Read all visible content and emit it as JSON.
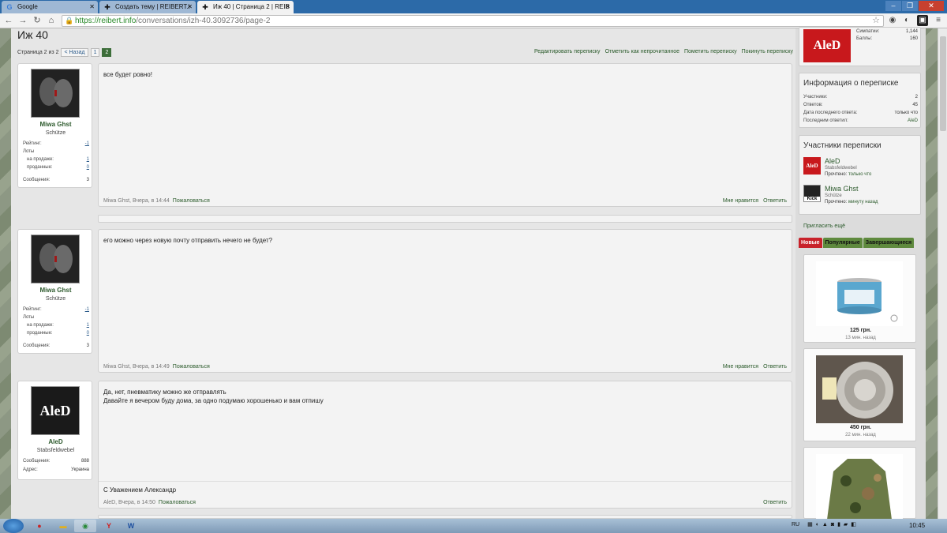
{
  "browser": {
    "tabs": [
      {
        "label": "Google",
        "icon": "google-icon"
      },
      {
        "label": "Создать тему | REIBERT.i",
        "icon": "reibert-icon"
      },
      {
        "label": "Иж 40 | Страница 2 | REIB",
        "icon": "reibert-icon"
      }
    ],
    "url_host": "https://reibert.info",
    "url_path": "/conversations/izh-40.3092736/page-2"
  },
  "page": {
    "title": "Иж 40",
    "page_label": "Страница 2 из 2",
    "prev_label": "< Назад",
    "pages": [
      "1",
      "2"
    ],
    "current_page": "2",
    "actions": [
      "Редактировать переписку",
      "Отметить как непрочитанное",
      "Пометить переписку",
      "Покинуть переписку"
    ]
  },
  "posts": [
    {
      "author": "Miwa Ghst",
      "rank": "Schütze",
      "stats": [
        {
          "label": "Рейтинг:",
          "value": "-1"
        },
        {
          "label": "Лоты",
          "value": ""
        },
        {
          "label": "на продаже:",
          "value": "1"
        },
        {
          "label": "проданные:",
          "value": "0"
        },
        {
          "label": "Сообщения:",
          "value": "3"
        }
      ],
      "text": "все будет ровно!",
      "meta": "Miwa Ghst, Вчера, в 14:44",
      "report": "Пожаловаться",
      "like": "Мне нравится",
      "reply": "Ответить"
    },
    {
      "author": "Miwa Ghst",
      "rank": "Schütze",
      "stats": [
        {
          "label": "Рейтинг:",
          "value": "-1"
        },
        {
          "label": "Лоты",
          "value": ""
        },
        {
          "label": "на продаже:",
          "value": "1"
        },
        {
          "label": "проданные:",
          "value": "0"
        },
        {
          "label": "Сообщения:",
          "value": "3"
        }
      ],
      "text": "его можно через новую почту отправить нечего не будет?",
      "meta": "Miwa Ghst, Вчера, в 14:49",
      "report": "Пожаловаться",
      "like": "Мне нравится",
      "reply": "Ответить"
    },
    {
      "author": "AleD",
      "rank": "Stabsfeldwebel",
      "stats": [
        {
          "label": "Сообщения:",
          "value": "888"
        },
        {
          "label": "Адрес:",
          "value": "Украина"
        }
      ],
      "text_line1": "Да, нет, пневматику можно же отправлять",
      "text_line2": "Давайте я вечером буду дома, за одно подумаю хорошенько и вам отпишу",
      "signature": "С Уважением Александр",
      "meta": "AleD, Вчера, в 14:50",
      "report": "Пожаловаться",
      "reply": "Ответить"
    }
  ],
  "sidebar": {
    "profile_stats": [
      {
        "label": "Симпатии:",
        "value": "1,144"
      },
      {
        "label": "Баллы:",
        "value": "160"
      }
    ],
    "brand": "AleD",
    "info_title": "Информация о переписке",
    "info": [
      {
        "label": "Участники:",
        "value": "2"
      },
      {
        "label": "Ответов:",
        "value": "45"
      },
      {
        "label": "Дата последнего ответа:",
        "value": "только что"
      },
      {
        "label": "Последним ответил:",
        "value": "AleD"
      }
    ],
    "participants_title": "Участники переписки",
    "participants": [
      {
        "name": "AleD",
        "rank": "Stabsfeldwebel",
        "seen_label": "Прочтено:",
        "seen": "только что"
      },
      {
        "name": "Miwa Ghst",
        "rank": "Schütze",
        "seen_label": "Прочтено:",
        "seen": "минуту назад",
        "badge": "Kick"
      }
    ],
    "invite": "Пригласить ещё",
    "tabs": [
      "Новые",
      "Популярные",
      "Завершающиеся"
    ],
    "listings": [
      {
        "price": "125 грн.",
        "ago": "13 мин. назад"
      },
      {
        "price": "450 грн.",
        "ago": "22 мин. назад"
      },
      {
        "price": "",
        "ago": ""
      }
    ]
  },
  "taskbar": {
    "lang": "RU",
    "time": "10:45"
  },
  "colors": {
    "accent_green": "#2d5a2d",
    "brand_red": "#c8181c",
    "active_page": "#3d6e3a"
  }
}
